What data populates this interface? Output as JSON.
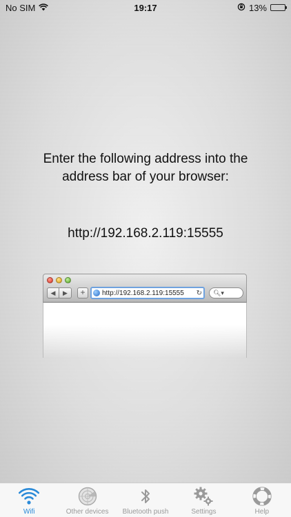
{
  "status_bar": {
    "carrier": "No SIM",
    "time": "19:17",
    "battery_percent": "13%",
    "battery_level": 0.13
  },
  "instruction": "Enter the following address into the address bar of your browser:",
  "address": "http://192.168.2.119:15555",
  "browser": {
    "url": "http://192.168.2.119:15555"
  },
  "tabs": [
    {
      "label": "Wifi",
      "icon": "wifi-icon",
      "active": true
    },
    {
      "label": "Other devices",
      "icon": "radar-icon",
      "active": false
    },
    {
      "label": "Bluetooth push",
      "icon": "bluetooth-icon",
      "active": false
    },
    {
      "label": "Settings",
      "icon": "gears-icon",
      "active": false
    },
    {
      "label": "Help",
      "icon": "lifebuoy-icon",
      "active": false
    }
  ],
  "colors": {
    "accent": "#2a8ad8",
    "inactive": "#999999",
    "battery_low": "#e0242b"
  }
}
